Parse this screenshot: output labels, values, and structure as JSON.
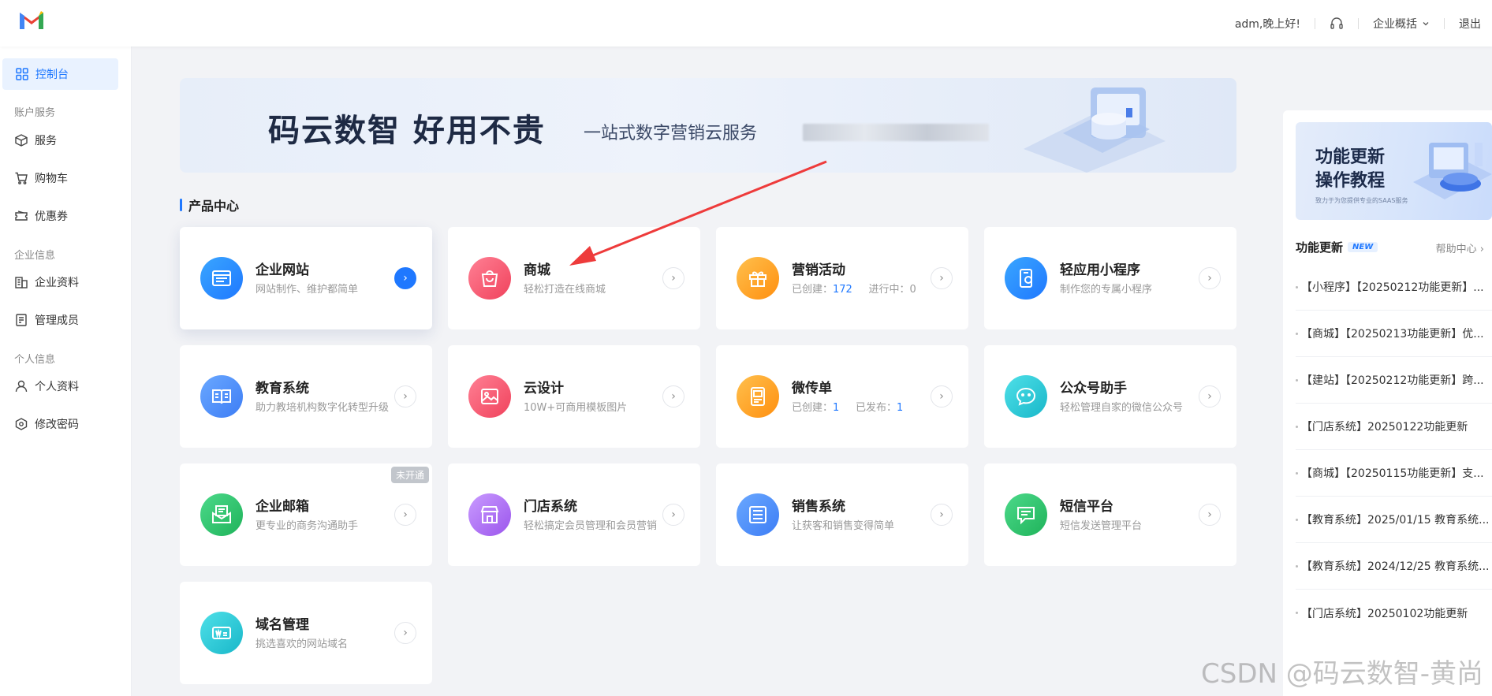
{
  "header": {
    "greeting": "adm,晚上好!",
    "company_menu": "企业概括",
    "logout": "退出",
    "colors": {
      "brand_red": "#e94235",
      "accent": "#1f78ff"
    }
  },
  "sidebar": {
    "active": {
      "label": "控制台",
      "icon": "grid-icon"
    },
    "groups": [
      {
        "label": "账户服务"
      },
      {
        "label": "企业信息"
      },
      {
        "label": "个人信息"
      }
    ],
    "items": [
      {
        "label": "服务",
        "icon": "box-icon"
      },
      {
        "label": "购物车",
        "icon": "cart-icon"
      },
      {
        "label": "优惠券",
        "icon": "coupon-icon"
      },
      {
        "label": "企业资料",
        "icon": "building-icon"
      },
      {
        "label": "管理成员",
        "icon": "member-icon"
      },
      {
        "label": "个人资料",
        "icon": "user-icon"
      },
      {
        "label": "修改密码",
        "icon": "lock-icon"
      }
    ]
  },
  "banner": {
    "headline": "码云数智  好用不贵",
    "subline": "一站式数字营销云服务"
  },
  "products": {
    "section_title": "产品中心",
    "cards": [
      {
        "title": "企业网站",
        "desc": "网站制作、维护都简单",
        "icon": "website-icon",
        "color": "#1f8bff"
      },
      {
        "title": "商城",
        "desc": "轻松打造在线商城",
        "icon": "shopping-bag-icon",
        "color": "#f25a6e"
      },
      {
        "title": "营销活动",
        "desc_created_label": "已创建：",
        "desc_created": "172",
        "desc_running_label": "进行中：",
        "desc_running": "0",
        "icon": "gift-icon",
        "color": "#ffa21a"
      },
      {
        "title": "轻应用小程序",
        "desc": "制作您的专属小程序",
        "icon": "mini-program-icon",
        "color": "#1f8bff"
      },
      {
        "title": "教育系统",
        "desc": "助力教培机构数字化转型升级",
        "icon": "book-icon",
        "color": "#3d8bff"
      },
      {
        "title": "云设计",
        "desc": "10W+可商用模板图片",
        "icon": "image-icon",
        "color": "#f25a6e"
      },
      {
        "title": "微传单",
        "desc_created_label": "已创建：",
        "desc_created": "1",
        "desc_published_label": "已发布：",
        "desc_published": "1",
        "icon": "flyer-icon",
        "color": "#ffa21a"
      },
      {
        "title": "公众号助手",
        "desc": "轻松管理自家的微信公众号",
        "icon": "wechat-icon",
        "color": "#22c7d6"
      },
      {
        "title": "企业邮箱",
        "desc": "更专业的商务沟通助手",
        "icon": "mail-icon",
        "color": "#2cc46b",
        "badge": "未开通"
      },
      {
        "title": "门店系统",
        "desc": "轻松搞定会员管理和会员营销",
        "icon": "store-icon",
        "color": "#b06ef5"
      },
      {
        "title": "销售系统",
        "desc": "让获客和销售变得简单",
        "icon": "list-icon",
        "color": "#3d8bff"
      },
      {
        "title": "短信平台",
        "desc": "短信发送管理平台",
        "icon": "sms-icon",
        "color": "#2cc46b"
      },
      {
        "title": "域名管理",
        "desc": "挑选喜欢的网站域名",
        "icon": "domain-icon",
        "color": "#22c7d6"
      }
    ]
  },
  "updates": {
    "promo_line1": "功能更新",
    "promo_line2": "操作教程",
    "promo_small": "致力于为您提供专业的SAAS服务",
    "title": "功能更新",
    "new_badge": "NEW",
    "help_link": "帮助中心",
    "items": [
      "【小程序】【20250212功能更新】...",
      "【商城】【20250213功能更新】优...",
      "【建站】【20250212功能更新】跨...",
      "【门店系统】20250122功能更新",
      "【商城】【20250115功能更新】支...",
      "【教育系统】2025/01/15 教育系统...",
      "【教育系统】2024/12/25 教育系统...",
      "【门店系统】20250102功能更新"
    ]
  },
  "watermark": "CSDN @码云数智-黄尚"
}
